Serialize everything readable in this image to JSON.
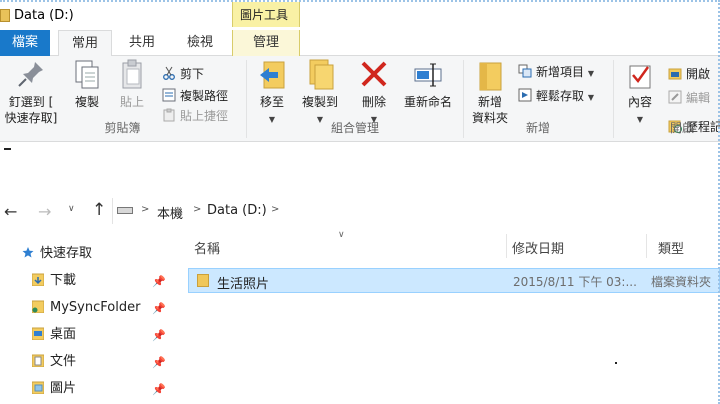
{
  "window": {
    "title": "Data (D:)",
    "context_tab_header": "圖片工具"
  },
  "tabs": [
    {
      "label": "檔案"
    },
    {
      "label": "常用"
    },
    {
      "label": "共用"
    },
    {
      "label": "檢視"
    },
    {
      "label": "管理"
    }
  ],
  "ribbon": {
    "clipboard": {
      "group_label": "剪貼簿",
      "pin_quick_access": "釘選到 [\n快速存取]",
      "copy": "複製",
      "paste": "貼上",
      "cut": "剪下",
      "copy_path": "複製路徑",
      "paste_shortcut": "貼上捷徑"
    },
    "organize": {
      "group_label": "組合管理",
      "move_to": "移至",
      "copy_to": "複製到",
      "delete": "刪除",
      "rename": "重新命名"
    },
    "new": {
      "group_label": "新增",
      "new_folder": "新增\n資料夾",
      "new_item": "新增項目",
      "easy_access": "輕鬆存取"
    },
    "open": {
      "group_label": "開啟",
      "properties": "內容",
      "open": "開啟",
      "edit": "編輯",
      "history": "歷程記"
    }
  },
  "address": {
    "segments": [
      "本機",
      "Data (D:)"
    ]
  },
  "navigation": {
    "quick_access": "快速存取",
    "items": [
      {
        "label": "下載",
        "pinned": true
      },
      {
        "label": "MySyncFolder",
        "pinned": true
      },
      {
        "label": "桌面",
        "pinned": true
      },
      {
        "label": "文件",
        "pinned": true
      },
      {
        "label": "圖片",
        "pinned": true
      }
    ]
  },
  "file_list": {
    "columns": [
      "名稱",
      "修改日期",
      "類型"
    ],
    "rows": [
      {
        "name": "生活照片",
        "modified": "2015/8/11 下午 03:...",
        "type": "檔案資料夾"
      }
    ]
  },
  "colors": {
    "file_tab": "#1979ca",
    "context_tab": "#f9f1a5",
    "selection": "#cce8ff",
    "folder": "#f0c75a"
  }
}
